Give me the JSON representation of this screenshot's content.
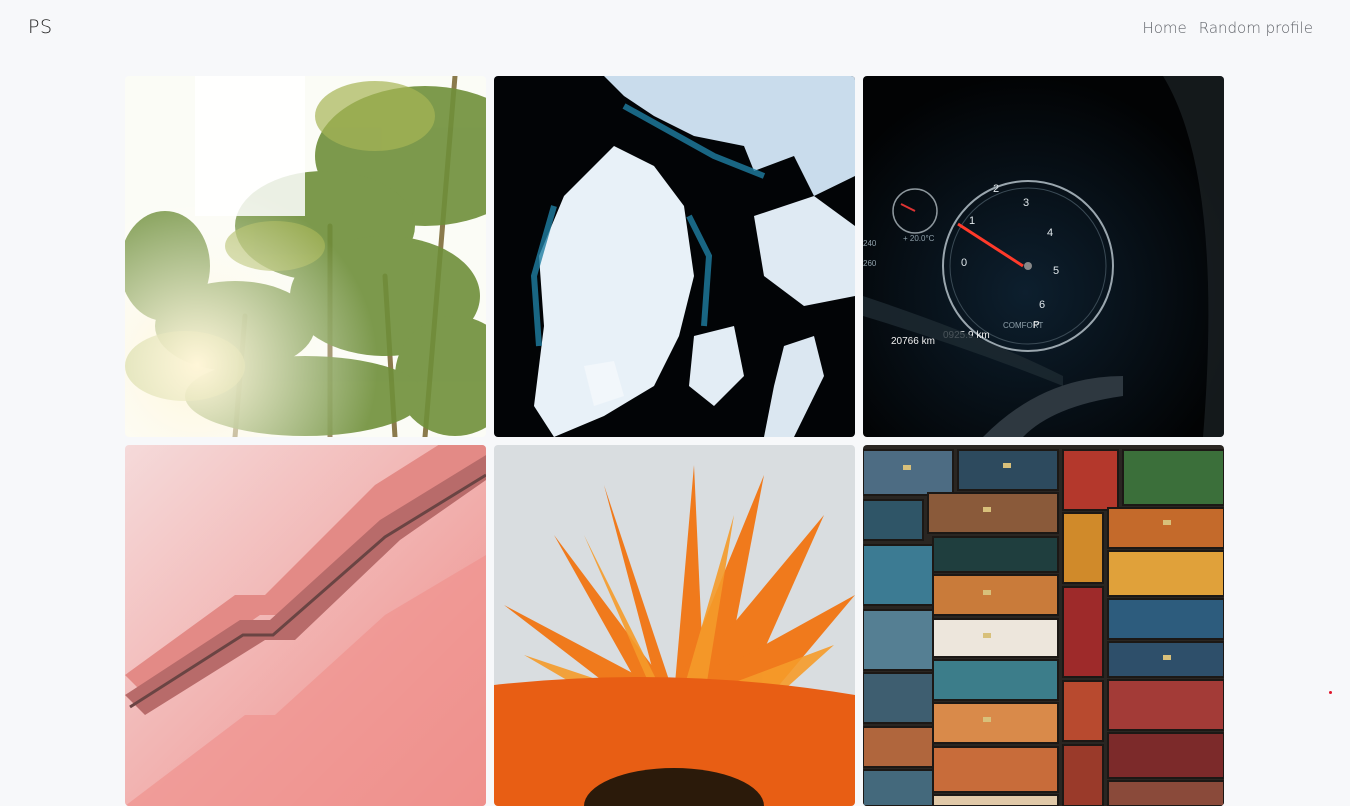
{
  "navbar": {
    "brand": "PS",
    "links": [
      {
        "label": "Home"
      },
      {
        "label": "Random profile"
      }
    ]
  },
  "gallery": {
    "photos": [
      {
        "subject": "palm trees against bright sky"
      },
      {
        "subject": "aerial view of ice floes on dark water"
      },
      {
        "subject": "car dashboard speedometer at night",
        "readouts": {
          "temp": "+ 20.0°C",
          "odo": "20766 km",
          "trip": "0925.9 km",
          "mode": "COMFORT",
          "gear": "P",
          "gauge": [
            "0",
            "1",
            "2",
            "3",
            "4",
            "5",
            "6"
          ],
          "speed": [
            "240",
            "260"
          ]
        }
      },
      {
        "subject": "pink escalator and staircase"
      },
      {
        "subject": "orange sunflower petals close-up"
      },
      {
        "subject": "stacked vintage suitcases"
      }
    ]
  },
  "colors": {
    "background": "#f7f8fa",
    "brand_text": "#222222",
    "nav_text": "#5f6268"
  }
}
